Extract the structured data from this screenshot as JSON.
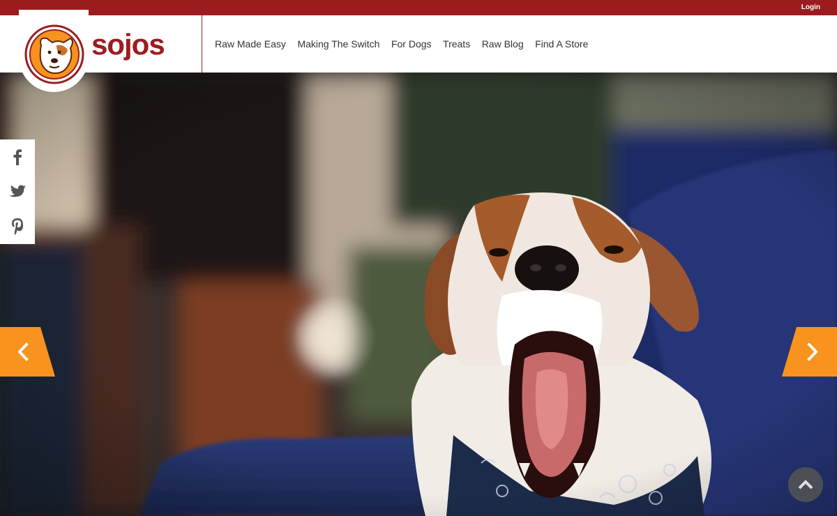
{
  "topbar": {
    "login_label": "Login"
  },
  "brand": {
    "name": "sojos"
  },
  "nav": {
    "items": [
      {
        "label": "Raw Made Easy"
      },
      {
        "label": "Making The Switch"
      },
      {
        "label": "For Dogs"
      },
      {
        "label": "Treats"
      },
      {
        "label": "Raw Blog"
      },
      {
        "label": "Find A Store"
      }
    ]
  },
  "social": {
    "icons": [
      "facebook-icon",
      "twitter-icon",
      "pinterest-icon"
    ]
  },
  "hero": {
    "image": "yawning-dog-photo"
  },
  "colors": {
    "brand_red": "#9b1c1f",
    "accent_orange": "#f7931e",
    "nav_text": "#333333"
  }
}
